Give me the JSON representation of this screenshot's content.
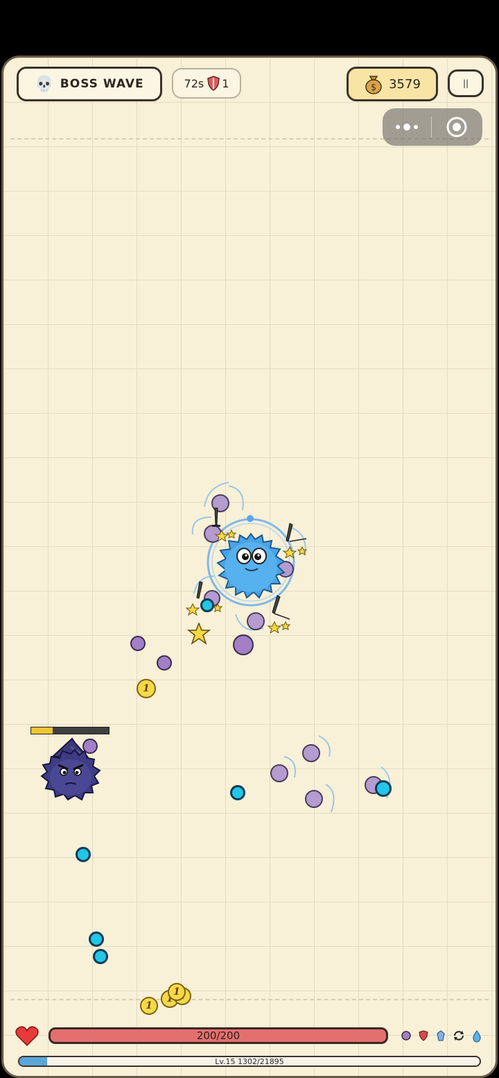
{
  "hud": {
    "wave_label": "BOSS WAVE",
    "wave_icon": "skull-icon",
    "timer": "72s",
    "shield_icon": "shield-icon",
    "shield_count": "1",
    "coins": "3579",
    "coin_icon": "money-bag-icon",
    "pause_label": "||"
  },
  "system": {
    "menu_icon": "more-dots-icon",
    "close_icon": "target-close-icon"
  },
  "player": {
    "name": "blue-fluffy-player",
    "health": "200/200",
    "health_fraction": 1.0,
    "level_text": "Lv.15 1302/21895",
    "xp_fraction": 0.06
  },
  "boss": {
    "name": "wizard-fluffy-boss",
    "health_fraction": 0.28
  },
  "status_effects": [
    "orb-icon",
    "shield-icon",
    "crystal-icon",
    "refresh-icon",
    "droplet-icon"
  ],
  "coin_label": "1",
  "colors": {
    "board_bg": "#f8f0d7",
    "hp_red": "#e46f6f",
    "xp_blue": "#5aa6d8",
    "orb_purple": "#a27fc7",
    "orb_cyan": "#22c6e6",
    "coin_gold": "#f7d84a",
    "boss_bar_yellow": "#f2c530"
  }
}
